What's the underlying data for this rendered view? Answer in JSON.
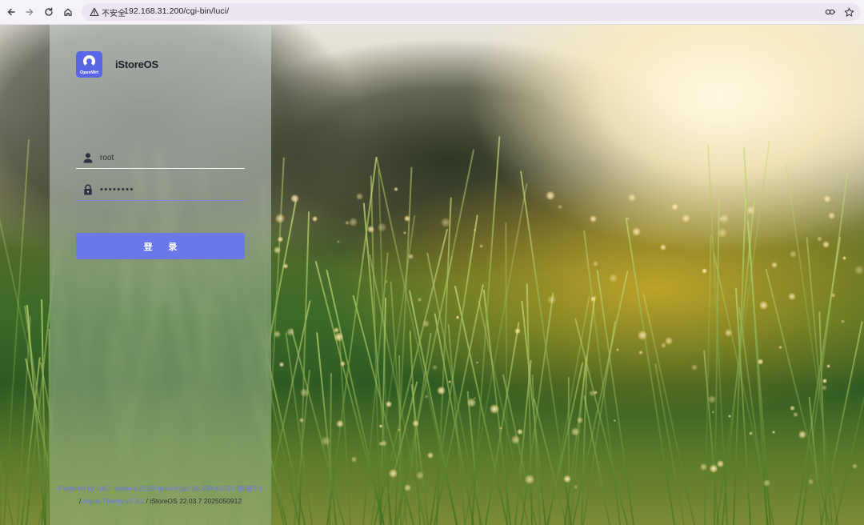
{
  "browser": {
    "security_label": "不安全",
    "url": "192.168.31.200/cgi-bin/luci/",
    "icons": [
      "back-icon",
      "forward-icon",
      "reload-icon",
      "home-icon",
      "warning-icon",
      "password-key-icon",
      "bookmark-star-icon"
    ]
  },
  "brand": {
    "logo_text": "OpenWrt",
    "name": "iStoreOS",
    "accent_color": "#5a66e6"
  },
  "login": {
    "username_value": "root",
    "password_value": "••••••••",
    "button_label": "登 录",
    "button_color": "#6a78e8"
  },
  "footer": {
    "powered_link": "Powered by LuCI istoreos-22.03 branch (git-24.339.46321-5f9267c)",
    "separator1": "/",
    "theme_link": "Argon Theme v2.3.1",
    "separator2": "/",
    "version_text": "iStoreOS 22.03.7 2025050912"
  }
}
